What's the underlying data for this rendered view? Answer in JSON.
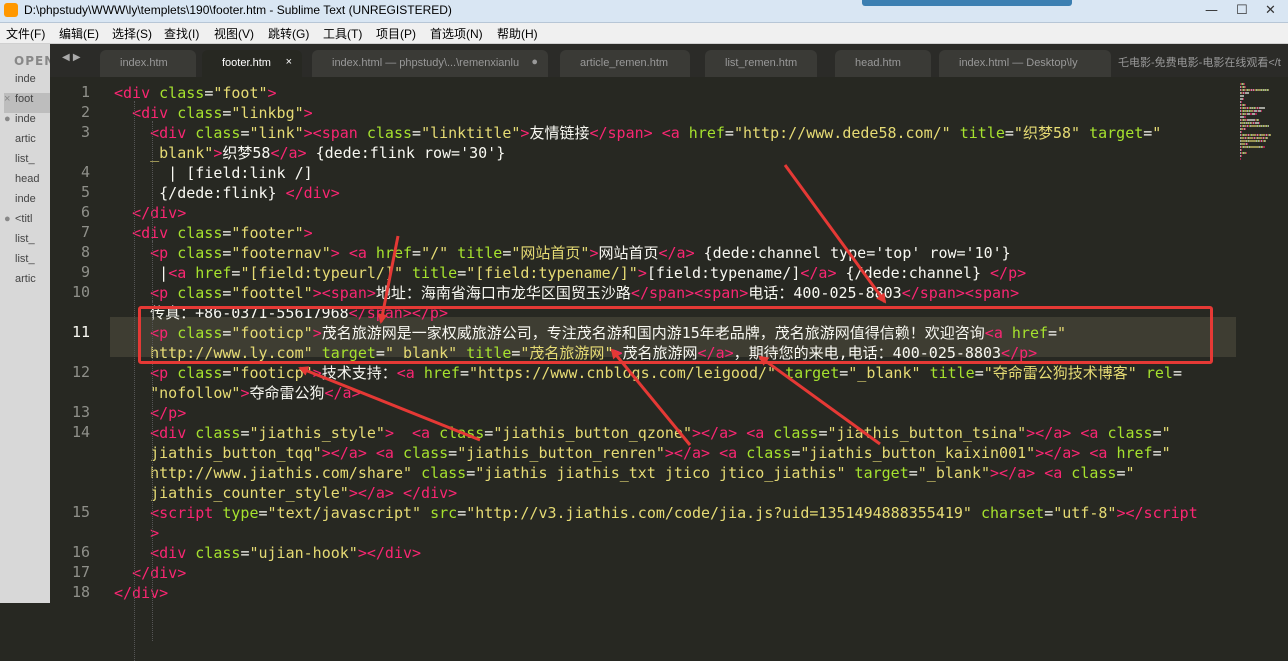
{
  "window": {
    "title": "D:\\phpstudy\\WWW\\ly\\templets\\190\\footer.htm - Sublime Text (UNREGISTERED)",
    "minimize": "—",
    "maximize": "☐",
    "close": "✕"
  },
  "menu": [
    "文件(F)",
    "编辑(E)",
    "选择(S)",
    "查找(I)",
    "视图(V)",
    "跳转(G)",
    "工具(T)",
    "项目(P)",
    "首选项(N)",
    "帮助(H)"
  ],
  "sidebar": {
    "heading": "OPEN",
    "files": [
      {
        "mark": "",
        "label": "inde"
      },
      {
        "mark": "×",
        "label": "foot"
      },
      {
        "mark": "●",
        "label": "inde"
      },
      {
        "mark": "",
        "label": "artic"
      },
      {
        "mark": "",
        "label": "list_"
      },
      {
        "mark": "",
        "label": "head"
      },
      {
        "mark": "",
        "label": "inde"
      },
      {
        "mark": "●",
        "label": "<titl"
      },
      {
        "mark": "",
        "label": "list_"
      },
      {
        "mark": "",
        "label": "list_"
      },
      {
        "mark": "",
        "label": "artic"
      }
    ]
  },
  "tabs": [
    {
      "label": "index.htm",
      "dot": ""
    },
    {
      "label": "footer.htm",
      "dot": "×"
    },
    {
      "label": "index.html — phpstudy\\...\\remenxianlu",
      "dot": "●"
    },
    {
      "label": "article_remen.htm",
      "dot": ""
    },
    {
      "label": "list_remen.htm",
      "dot": ""
    },
    {
      "label": "head.htm",
      "dot": ""
    },
    {
      "label": "index.html — Desktop\\ly",
      "dot": ""
    }
  ],
  "tab_overflow": "乇电影-免费电影-电影在线观看</t",
  "line_numbers": [
    "1",
    "2",
    "3",
    "",
    "4",
    "5",
    "6",
    "7",
    "8",
    "9",
    "10",
    "",
    "11",
    "",
    "12",
    "",
    "13",
    "14",
    "",
    "",
    "",
    "15",
    "",
    "16",
    "17",
    "18"
  ],
  "code_lines": [
    [
      [
        "tg",
        "<div "
      ],
      [
        "at",
        "class"
      ],
      [
        "tx",
        "="
      ],
      [
        "st",
        "\"foot\""
      ],
      [
        "tg",
        ">"
      ]
    ],
    [
      [
        "tx",
        "  "
      ],
      [
        "tg",
        "<div "
      ],
      [
        "at",
        "class"
      ],
      [
        "tx",
        "="
      ],
      [
        "st",
        "\"linkbg\""
      ],
      [
        "tg",
        ">"
      ]
    ],
    [
      [
        "tx",
        "    "
      ],
      [
        "tg",
        "<div "
      ],
      [
        "at",
        "class"
      ],
      [
        "tx",
        "="
      ],
      [
        "st",
        "\"link\""
      ],
      [
        "tg",
        "><span "
      ],
      [
        "at",
        "class"
      ],
      [
        "tx",
        "="
      ],
      [
        "st",
        "\"linktitle\""
      ],
      [
        "tg",
        ">"
      ],
      [
        "tx",
        "友情链接"
      ],
      [
        "tg",
        "</span>"
      ],
      [
        "tx",
        " "
      ],
      [
        "tg",
        "<a "
      ],
      [
        "at",
        "href"
      ],
      [
        "tx",
        "="
      ],
      [
        "st",
        "\"http://www.dede58.com/\""
      ],
      [
        "tx",
        " "
      ],
      [
        "at",
        "title"
      ],
      [
        "tx",
        "="
      ],
      [
        "st",
        "\"织梦58\""
      ],
      [
        "tx",
        " "
      ],
      [
        "at",
        "target"
      ],
      [
        "tx",
        "="
      ],
      [
        "st",
        "\""
      ]
    ],
    [
      [
        "tx",
        "    "
      ],
      [
        "st",
        "_blank\""
      ],
      [
        "tg",
        ">"
      ],
      [
        "tx",
        "织梦58"
      ],
      [
        "tg",
        "</a>"
      ],
      [
        "tx",
        " {dede:flink row='30'}"
      ]
    ],
    [
      [
        "tx",
        "      | [field:link /]"
      ]
    ],
    [
      [
        "tx",
        "     {/dede:flink} "
      ],
      [
        "tg",
        "</div>"
      ]
    ],
    [
      [
        "tx",
        "  "
      ],
      [
        "tg",
        "</div>"
      ]
    ],
    [
      [
        "tx",
        "  "
      ],
      [
        "tg",
        "<div "
      ],
      [
        "at",
        "class"
      ],
      [
        "tx",
        "="
      ],
      [
        "st",
        "\"footer\""
      ],
      [
        "tg",
        ">"
      ]
    ],
    [
      [
        "tx",
        "    "
      ],
      [
        "tg",
        "<p "
      ],
      [
        "at",
        "class"
      ],
      [
        "tx",
        "="
      ],
      [
        "st",
        "\"footernav\""
      ],
      [
        "tg",
        ">"
      ],
      [
        "tx",
        " "
      ],
      [
        "tg",
        "<a "
      ],
      [
        "at",
        "href"
      ],
      [
        "tx",
        "="
      ],
      [
        "st",
        "\"/\""
      ],
      [
        "tx",
        " "
      ],
      [
        "at",
        "title"
      ],
      [
        "tx",
        "="
      ],
      [
        "st",
        "\"网站首页\""
      ],
      [
        "tg",
        ">"
      ],
      [
        "tx",
        "网站首页"
      ],
      [
        "tg",
        "</a>"
      ],
      [
        "tx",
        " {dede:channel type='top' row='10'}"
      ]
    ],
    [
      [
        "tx",
        "     |"
      ],
      [
        "tg",
        "<a "
      ],
      [
        "at",
        "href"
      ],
      [
        "tx",
        "="
      ],
      [
        "st",
        "\"[field:typeurl/]\""
      ],
      [
        "tx",
        " "
      ],
      [
        "at",
        "title"
      ],
      [
        "tx",
        "="
      ],
      [
        "st",
        "\"[field:typename/]\""
      ],
      [
        "tg",
        ">"
      ],
      [
        "tx",
        "[field:typename/]"
      ],
      [
        "tg",
        "</a>"
      ],
      [
        "tx",
        " {/dede:channel} "
      ],
      [
        "tg",
        "</p>"
      ]
    ],
    [
      [
        "tx",
        "    "
      ],
      [
        "tg",
        "<p "
      ],
      [
        "at",
        "class"
      ],
      [
        "tx",
        "="
      ],
      [
        "st",
        "\"foottel\""
      ],
      [
        "tg",
        "><span>"
      ],
      [
        "tx",
        "地址：海南省海口市龙华区国贸玉沙路"
      ],
      [
        "tg",
        "</span><span>"
      ],
      [
        "tx",
        "电话：400-025-8803"
      ],
      [
        "tg",
        "</span><span>"
      ]
    ],
    [
      [
        "tx",
        "    传真：+86-0371-55617968"
      ],
      [
        "tg",
        "</span></p>"
      ]
    ],
    [
      [
        "tx",
        "    "
      ],
      [
        "tg",
        "<p "
      ],
      [
        "at",
        "class"
      ],
      [
        "tx",
        "="
      ],
      [
        "st",
        "\"footicp\""
      ],
      [
        "tg",
        ">"
      ],
      [
        "tx",
        "茂名旅游网是一家权威旅游公司，专注茂名游和国内游15年老品牌，茂名旅游网值得信赖！欢迎咨询"
      ],
      [
        "tg",
        "<a "
      ],
      [
        "at",
        "href"
      ],
      [
        "tx",
        "="
      ],
      [
        "st",
        "\""
      ]
    ],
    [
      [
        "tx",
        "    "
      ],
      [
        "st",
        "http://www.ly.com\""
      ],
      [
        "tx",
        " "
      ],
      [
        "at",
        "target"
      ],
      [
        "tx",
        "="
      ],
      [
        "st",
        "\"_blank\""
      ],
      [
        "tx",
        " "
      ],
      [
        "at",
        "title"
      ],
      [
        "tx",
        "="
      ],
      [
        "st",
        "\"茂名旅游网\""
      ],
      [
        "tg",
        ">"
      ],
      [
        "tx",
        "茂名旅游网"
      ],
      [
        "tg",
        "</a>"
      ],
      [
        "tx",
        "，期待您的来电,电话：400-025-8803"
      ],
      [
        "tg",
        "</p>"
      ]
    ],
    [
      [
        "tx",
        "    "
      ],
      [
        "tg",
        "<p "
      ],
      [
        "at",
        "class"
      ],
      [
        "tx",
        "="
      ],
      [
        "st",
        "\"footicp\""
      ],
      [
        "tg",
        ">"
      ],
      [
        "tx",
        "技术支持："
      ],
      [
        "tg",
        "<a "
      ],
      [
        "at",
        "href"
      ],
      [
        "tx",
        "="
      ],
      [
        "st",
        "\"https://www.cnblogs.com/leigood/\""
      ],
      [
        "tx",
        " "
      ],
      [
        "at",
        "target"
      ],
      [
        "tx",
        "="
      ],
      [
        "st",
        "\"_blank\""
      ],
      [
        "tx",
        " "
      ],
      [
        "at",
        "title"
      ],
      [
        "tx",
        "="
      ],
      [
        "st",
        "\"夺命雷公狗技术博客\""
      ],
      [
        "tx",
        " "
      ],
      [
        "at",
        "rel"
      ],
      [
        "tx",
        "="
      ]
    ],
    [
      [
        "tx",
        "    "
      ],
      [
        "st",
        "\"nofollow\""
      ],
      [
        "tg",
        ">"
      ],
      [
        "tx",
        "夺命雷公狗"
      ],
      [
        "tg",
        "</a>"
      ]
    ],
    [
      [
        "tx",
        "    "
      ],
      [
        "tg",
        "</p>"
      ]
    ],
    [
      [
        "tx",
        "    "
      ],
      [
        "tg",
        "<div "
      ],
      [
        "at",
        "class"
      ],
      [
        "tx",
        "="
      ],
      [
        "st",
        "\"jiathis_style\""
      ],
      [
        "tg",
        ">"
      ],
      [
        "tx",
        "  "
      ],
      [
        "tg",
        "<a "
      ],
      [
        "at",
        "class"
      ],
      [
        "tx",
        "="
      ],
      [
        "st",
        "\"jiathis_button_qzone\""
      ],
      [
        "tg",
        "></a>"
      ],
      [
        "tx",
        " "
      ],
      [
        "tg",
        "<a "
      ],
      [
        "at",
        "class"
      ],
      [
        "tx",
        "="
      ],
      [
        "st",
        "\"jiathis_button_tsina\""
      ],
      [
        "tg",
        "></a>"
      ],
      [
        "tx",
        " "
      ],
      [
        "tg",
        "<a "
      ],
      [
        "at",
        "class"
      ],
      [
        "tx",
        "="
      ],
      [
        "st",
        "\""
      ]
    ],
    [
      [
        "tx",
        "    "
      ],
      [
        "st",
        "jiathis_button_tqq\""
      ],
      [
        "tg",
        "></a>"
      ],
      [
        "tx",
        " "
      ],
      [
        "tg",
        "<a "
      ],
      [
        "at",
        "class"
      ],
      [
        "tx",
        "="
      ],
      [
        "st",
        "\"jiathis_button_renren\""
      ],
      [
        "tg",
        "></a>"
      ],
      [
        "tx",
        " "
      ],
      [
        "tg",
        "<a "
      ],
      [
        "at",
        "class"
      ],
      [
        "tx",
        "="
      ],
      [
        "st",
        "\"jiathis_button_kaixin001\""
      ],
      [
        "tg",
        "></a>"
      ],
      [
        "tx",
        " "
      ],
      [
        "tg",
        "<a "
      ],
      [
        "at",
        "href"
      ],
      [
        "tx",
        "="
      ],
      [
        "st",
        "\""
      ]
    ],
    [
      [
        "tx",
        "    "
      ],
      [
        "st",
        "http://www.jiathis.com/share\""
      ],
      [
        "tx",
        " "
      ],
      [
        "at",
        "class"
      ],
      [
        "tx",
        "="
      ],
      [
        "st",
        "\"jiathis jiathis_txt jtico jtico_jiathis\""
      ],
      [
        "tx",
        " "
      ],
      [
        "at",
        "target"
      ],
      [
        "tx",
        "="
      ],
      [
        "st",
        "\"_blank\""
      ],
      [
        "tg",
        "></a>"
      ],
      [
        "tx",
        " "
      ],
      [
        "tg",
        "<a "
      ],
      [
        "at",
        "class"
      ],
      [
        "tx",
        "="
      ],
      [
        "st",
        "\""
      ]
    ],
    [
      [
        "tx",
        "    "
      ],
      [
        "st",
        "jiathis_counter_style\""
      ],
      [
        "tg",
        "></a>"
      ],
      [
        "tx",
        " "
      ],
      [
        "tg",
        "</div>"
      ]
    ],
    [
      [
        "tx",
        "    "
      ],
      [
        "tg",
        "<script "
      ],
      [
        "at",
        "type"
      ],
      [
        "tx",
        "="
      ],
      [
        "st",
        "\"text/javascript\""
      ],
      [
        "tx",
        " "
      ],
      [
        "at",
        "src"
      ],
      [
        "tx",
        "="
      ],
      [
        "st",
        "\"http://v3.jiathis.com/code/jia.js?uid=1351494888355419\""
      ],
      [
        "tx",
        " "
      ],
      [
        "at",
        "charset"
      ],
      [
        "tx",
        "="
      ],
      [
        "st",
        "\"utf-8\""
      ],
      [
        "tg",
        "></script"
      ]
    ],
    [
      [
        "tx",
        "    "
      ],
      [
        "tg",
        ">"
      ]
    ],
    [
      [
        "tx",
        "    "
      ],
      [
        "tg",
        "<div "
      ],
      [
        "at",
        "class"
      ],
      [
        "tx",
        "="
      ],
      [
        "st",
        "\"ujian-hook\""
      ],
      [
        "tg",
        "></div>"
      ]
    ],
    [
      [
        "tx",
        "  "
      ],
      [
        "tg",
        "</div>"
      ]
    ],
    [
      [
        "tg",
        "</div>"
      ]
    ]
  ],
  "colors": {
    "background": "#272822",
    "tag": "#f92672",
    "attribute": "#a6e22e",
    "string": "#e6db74",
    "text": "#f8f8f2",
    "annotation": "#e53935"
  }
}
